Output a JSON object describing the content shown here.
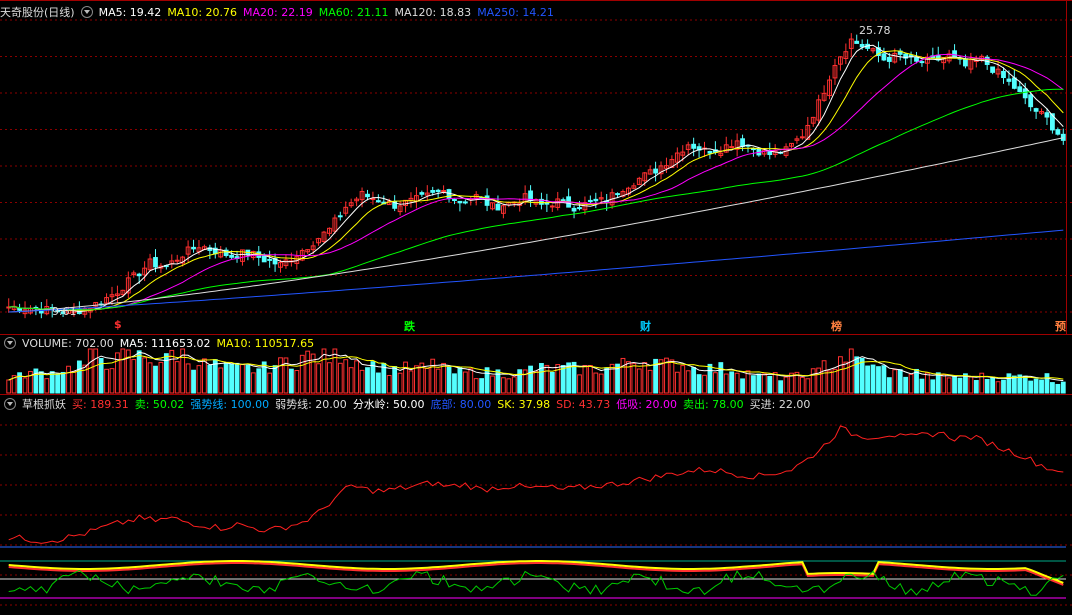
{
  "header": {
    "title": "天奇股份(日线)",
    "ma_items": [
      {
        "label": "MA5: 19.42",
        "color": "#ffffff"
      },
      {
        "label": "MA10: 20.76",
        "color": "#ffff00"
      },
      {
        "label": "MA20: 22.19",
        "color": "#ff00ff"
      },
      {
        "label": "MA60: 21.11",
        "color": "#00ff00"
      },
      {
        "label": "MA120: 18.83",
        "color": "#dddddd"
      },
      {
        "label": "MA250: 14.21",
        "color": "#2255ff"
      }
    ]
  },
  "price_panel": {
    "max_label": "25.78",
    "min_label": "9.61",
    "events": [
      {
        "label": "$",
        "color": "#ff3030"
      },
      {
        "label": "跌",
        "color": "#00ff00"
      },
      {
        "label": "财",
        "color": "#00ccff"
      },
      {
        "label": "榜",
        "color": "#ff8040"
      },
      {
        "label": "预",
        "color": "#ff8040"
      }
    ]
  },
  "volume_header": {
    "items": [
      {
        "label": "VOLUME: 702.00",
        "color": "#dddddd"
      },
      {
        "label": "MA5: 111653.02",
        "color": "#ffffff"
      },
      {
        "label": "MA10: 110517.65",
        "color": "#ffff00"
      }
    ]
  },
  "indicator_header": {
    "title": "草根抓妖",
    "items": [
      {
        "label": "买: 189.31",
        "color": "#ff3030"
      },
      {
        "label": "卖: 50.02",
        "color": "#00ff00"
      },
      {
        "label": "强势线: 100.00",
        "color": "#00aaff"
      },
      {
        "label": "弱势线: 20.00",
        "color": "#dddddd"
      },
      {
        "label": "分水岭: 50.00",
        "color": "#ffffff"
      },
      {
        "label": "底部: 80.00",
        "color": "#2255ff"
      },
      {
        "label": "SK: 37.98",
        "color": "#ffff00"
      },
      {
        "label": "SD: 43.73",
        "color": "#ff3030"
      },
      {
        "label": "低吸: 20.00",
        "color": "#ff00ff"
      },
      {
        "label": "卖出: 78.00",
        "color": "#00ff00"
      },
      {
        "label": "买进: 22.00",
        "color": "#dddddd"
      }
    ]
  },
  "colors": {
    "up": "#ff3030",
    "down": "#54ffff",
    "bg": "#000000",
    "grid": "#8b0000"
  },
  "chart_data": {
    "type": "candlestick",
    "price_axis": {
      "min": 9.61,
      "max": 25.78
    },
    "close_series": [
      9.9,
      9.8,
      9.7,
      9.6,
      9.8,
      10.2,
      10.8,
      11.6,
      12.4,
      12.2,
      12.9,
      13.4,
      13.1,
      12.8,
      13.0,
      12.6,
      12.3,
      12.9,
      13.6,
      14.3,
      15.6,
      16.3,
      16.0,
      15.7,
      15.9,
      16.2,
      16.5,
      15.9,
      16.2,
      15.6,
      15.8,
      16.1,
      15.7,
      15.9,
      15.6,
      15.8,
      16.0,
      16.7,
      17.2,
      17.7,
      18.4,
      19.2,
      18.8,
      18.9,
      19.4,
      18.9,
      18.6,
      18.8,
      19.7,
      21.5,
      23.8,
      25.1,
      24.6,
      24.0,
      24.2,
      23.8,
      23.9,
      24.2,
      23.6,
      24.0,
      23.2,
      22.4,
      21.3,
      20.6,
      19.4
    ],
    "volume_series": [
      0.4,
      0.5,
      0.5,
      0.6,
      0.7,
      0.9,
      0.8,
      0.9,
      0.9,
      0.8,
      1.0,
      0.8,
      0.7,
      0.6,
      0.6,
      0.6,
      0.7,
      0.8,
      0.9,
      0.9,
      1.0,
      0.8,
      0.7,
      0.6,
      0.6,
      0.6,
      0.7,
      0.5,
      0.5,
      0.5,
      0.5,
      0.5,
      0.6,
      0.6,
      0.6,
      0.6,
      0.6,
      0.7,
      0.8,
      0.8,
      0.7,
      0.7,
      0.6,
      0.6,
      0.6,
      0.5,
      0.4,
      0.4,
      0.4,
      0.5,
      0.7,
      0.9,
      0.8,
      0.6,
      0.5,
      0.5,
      0.4,
      0.4,
      0.4,
      0.4,
      0.4,
      0.4,
      0.4,
      0.4,
      0.3
    ],
    "buy_line": [
      90,
      88,
      85,
      87,
      92,
      98,
      106,
      112,
      118,
      115,
      118,
      112,
      108,
      104,
      109,
      104,
      100,
      106,
      112,
      126,
      148,
      166,
      160,
      158,
      162,
      166,
      170,
      165,
      168,
      160,
      164,
      166,
      162,
      164,
      160,
      163,
      166,
      168,
      172,
      176,
      180,
      185,
      188,
      190,
      186,
      182,
      180,
      185,
      190,
      205,
      225,
      250,
      240,
      238,
      242,
      236,
      240,
      244,
      236,
      238,
      230,
      220,
      212,
      200,
      189.31
    ]
  }
}
